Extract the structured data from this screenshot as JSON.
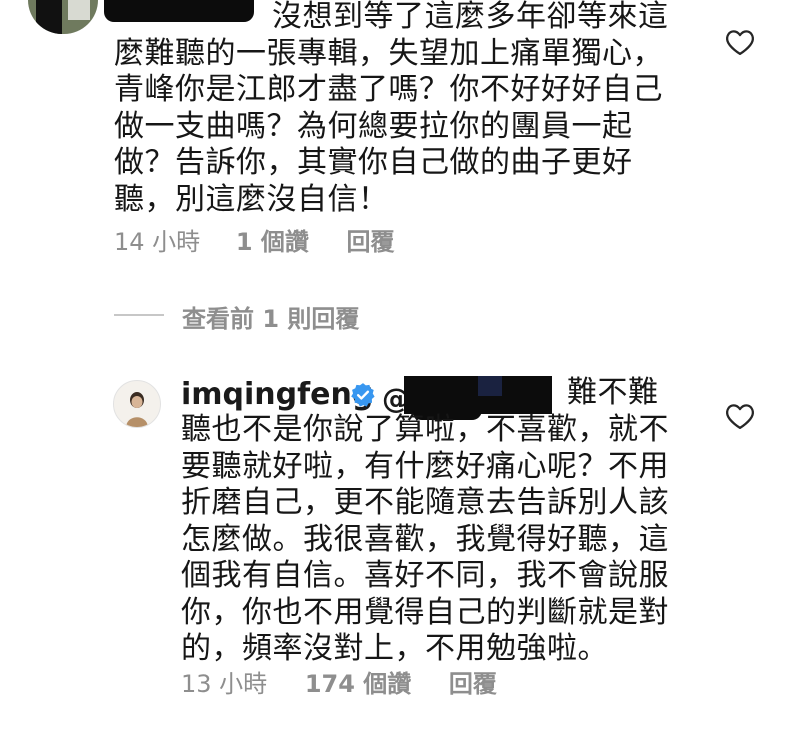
{
  "comment1": {
    "text_lines": [
      "沒想到等了這麼多年卻等來這",
      "麼難聽的一張專輯，失望加上痛單獨心，",
      "青峰你是江郎才盡了嗎？你不好好好自己",
      "做一支曲嗎？為何總要拉你的團員一起",
      "做？告訴你，其實你自己做的曲子更好",
      "聽，別這麼沒自信！"
    ],
    "time": "14 小時",
    "likes": "1 個讚",
    "reply": "回覆"
  },
  "view_replies": "查看前 1 則回覆",
  "reply1": {
    "username": "imqingfeng",
    "first_line_tail": "難不難",
    "text_lines": [
      "聽也不是你說了算啦，不喜歡，就不",
      "要聽就好啦，有什麼好痛心呢？不用",
      "折磨自己，更不能隨意去告訴別人該",
      "怎麼做。我很喜歡，我覺得好聽，這",
      "個我有自信。喜好不同，我不會說服",
      "你，你也不用覺得自己的判斷就是對",
      "的，頻率沒對上，不用勉強啦。"
    ],
    "time": "13 小時",
    "likes": "174 個讚",
    "reply": "回覆"
  },
  "icons": {
    "like": "heart-outline-icon",
    "verified": "verified-badge-icon"
  },
  "colors": {
    "verified": "#3897f0",
    "meta": "#8e8e8e",
    "text": "#161616"
  }
}
